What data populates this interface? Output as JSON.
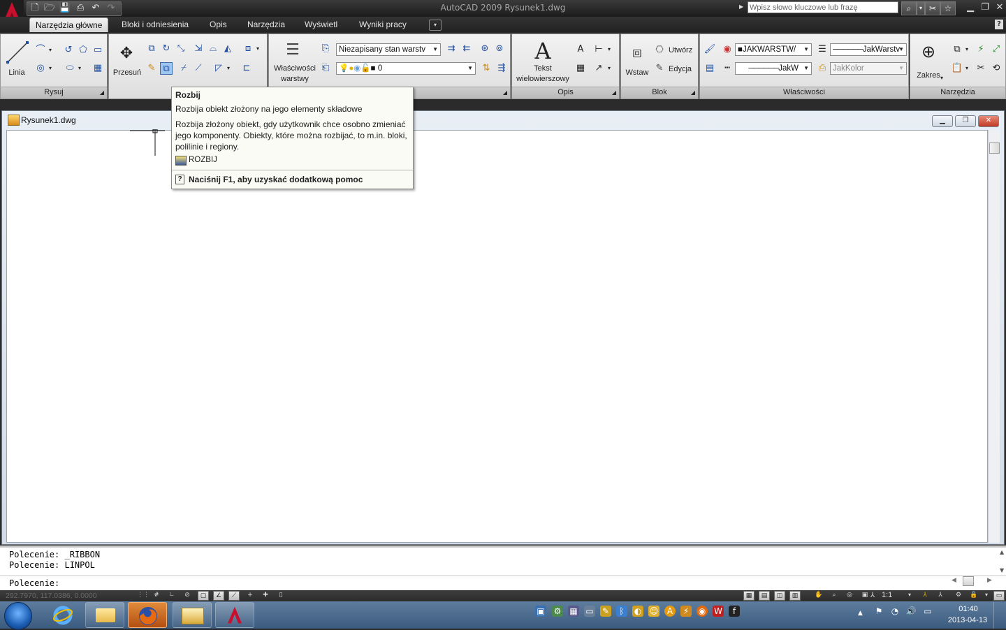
{
  "window": {
    "title": "AutoCAD 2009 Rysunek1.dwg"
  },
  "search": {
    "placeholder": "Wpisz słowo kluczowe lub frazę"
  },
  "tabs": [
    {
      "label": "Narzędzia główne",
      "active": true
    },
    {
      "label": "Bloki i odniesienia"
    },
    {
      "label": "Opis"
    },
    {
      "label": "Narzędzia"
    },
    {
      "label": "Wyświetl"
    },
    {
      "label": "Wyniki pracy"
    }
  ],
  "ribbon": {
    "draw": {
      "panel_label": "Rysuj",
      "line_label": "Linia"
    },
    "modify": {
      "move_label": "Przesuń"
    },
    "layers": {
      "props_label_1": "Właściwości",
      "props_label_2": "warstwy",
      "layer_state": "Niezapisany stan warstv",
      "current_layer": "0"
    },
    "annotation": {
      "mtext_label_1": "Tekst",
      "mtext_label_2": "wielowierszowy",
      "panel_label": "Opis"
    },
    "block": {
      "insert_label": "Wstaw",
      "create_label": "Utwórz",
      "edit_label": "Edycja",
      "panel_label": "Blok"
    },
    "properties": {
      "color": "JAKWARSTW/",
      "linetype": "JakWarstv",
      "lineweight": "JakW",
      "plotstyle": "JakKolor",
      "panel_label": "Właściwości"
    },
    "utilities": {
      "zoom_label": "Zakres",
      "panel_label": "Narzędzia"
    }
  },
  "tooltip": {
    "title": "Rozbij",
    "short": "Rozbija obiekt złożony na jego elementy składowe",
    "long": "Rozbija złożony obiekt, gdy użytkownik chce osobno zmieniać jego komponenty. Obiekty, które można rozbijać, to m.in. bloki, polilinie i regiony.",
    "command": "ROZBIJ",
    "help": "Naciśnij F1, aby uzyskać dodatkową pomoc"
  },
  "drawing": {
    "title": "Rysunek1.dwg"
  },
  "command_line": {
    "history": [
      "Polecenie: _RIBBON",
      "Polecenie: LINPOL"
    ],
    "prompt": "Polecenie:"
  },
  "statusbar": {
    "coords": "292.7970, 117.0386, 0.0000",
    "scale": "1:1"
  },
  "taskbar": {
    "time": "01:40",
    "date": "2013-04-13"
  },
  "colors": {
    "autocad_red": "#c8102e",
    "ribbon_bg": "#e8e8e8",
    "titlebar": "#1c1c1c"
  }
}
